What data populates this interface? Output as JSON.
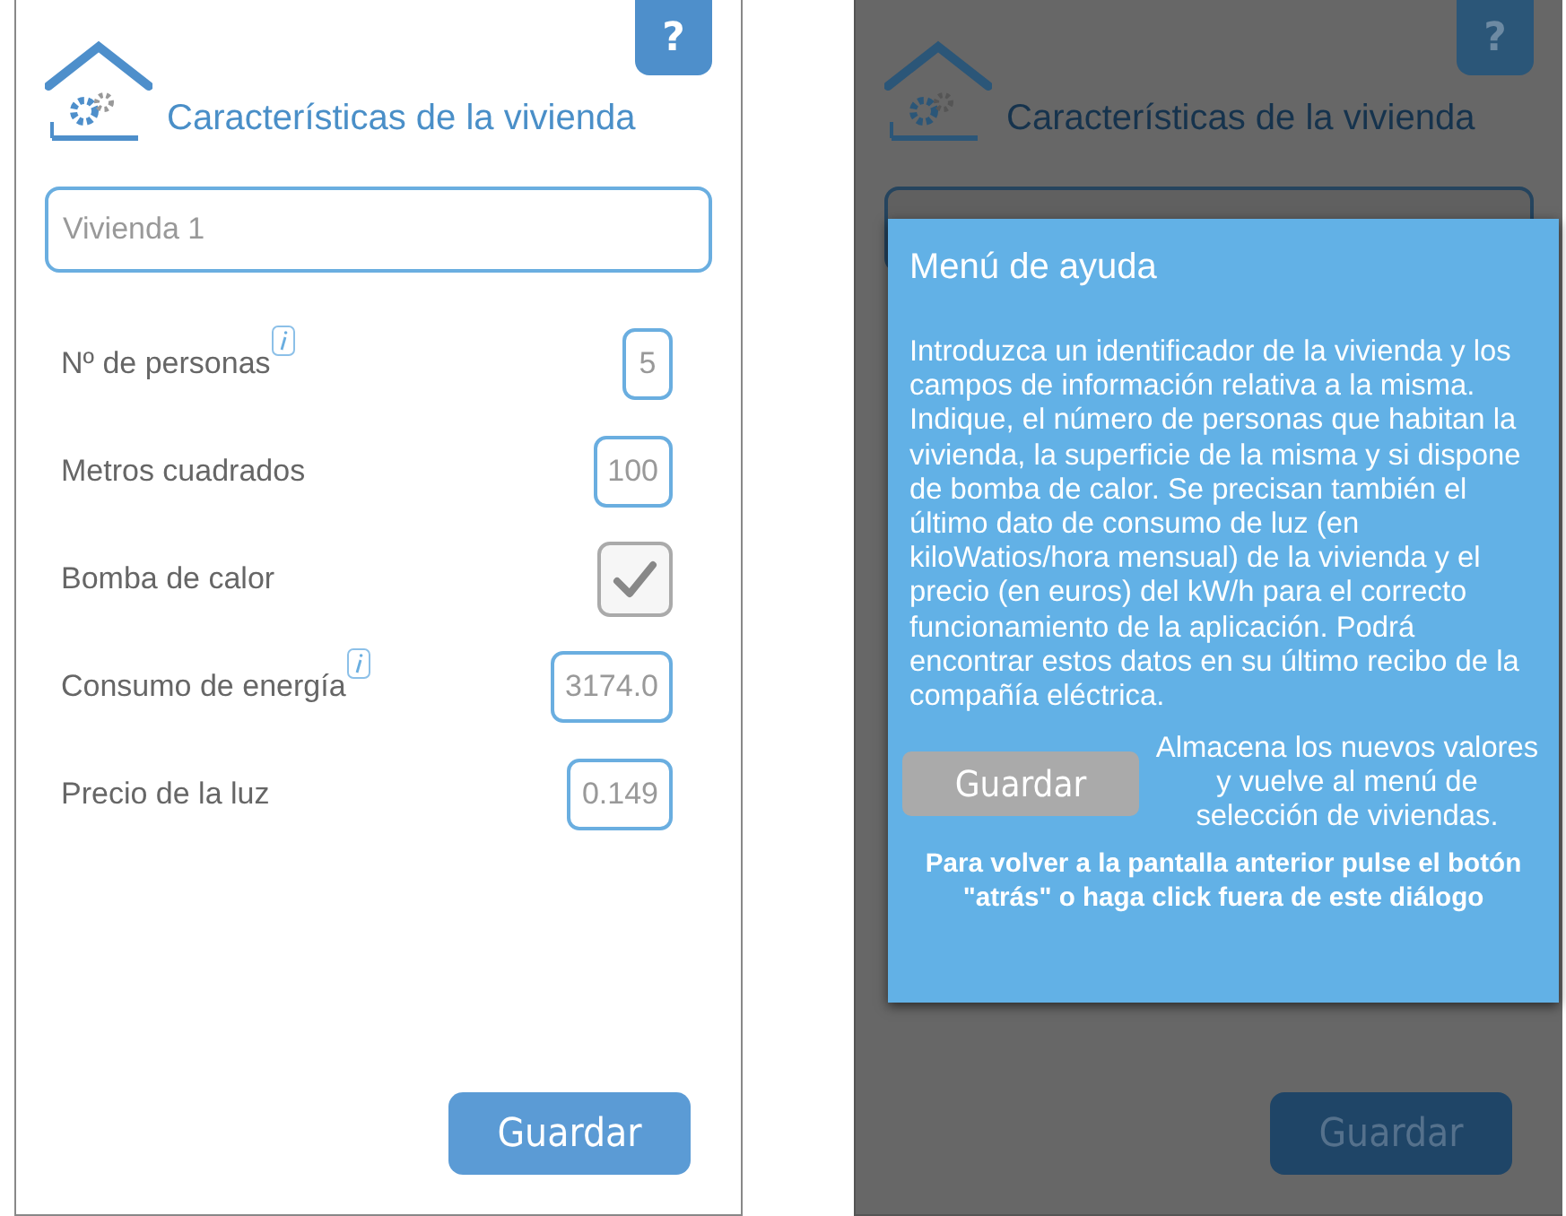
{
  "form_screen": {
    "header": {
      "title": "Características de la vivienda",
      "help_button": "?"
    },
    "name_field": {
      "value": "Vivienda 1"
    },
    "rows": [
      {
        "kind": "number",
        "label": "Nº de personas",
        "info": true,
        "value": "5"
      },
      {
        "kind": "number",
        "label": "Metros cuadrados",
        "info": false,
        "value": "100"
      },
      {
        "kind": "checkbox",
        "label": "Bomba de calor",
        "info": false,
        "checked": true
      },
      {
        "kind": "number",
        "label": "Consumo de energía",
        "info": true,
        "value": "3174.0"
      },
      {
        "kind": "number",
        "label": "Precio de la luz",
        "info": false,
        "value": "0.149"
      }
    ],
    "save_button": "Guardar"
  },
  "help_screen": {
    "header": {
      "title": "Características de la vivienda",
      "help_button": "?"
    },
    "save_button": "Guardar",
    "dialog": {
      "title": "Menú de ayuda",
      "body": "Introduzca un identificador de la vivienda y los campos de información relativa a la misma. Indique, el número de personas que habitan la vivienda, la superficie de la misma y si dispone de bomba de calor. Se precisan también el último dato de consumo de luz (en kiloWatios/hora mensual) de la vivienda y el precio (en euros) del kW/h para el correcto funcionamiento de la aplicación. Podrá encontrar estos datos en su último recibo de la compañía eléctrica.",
      "button": "Guardar",
      "button_note": "Almacena los nuevos valores y vuelve al menú de selección de viviendas.",
      "footer": "Para volver a la pantalla anterior pulse el botón \"atrás\" o haga click fuera de este diálogo"
    }
  }
}
